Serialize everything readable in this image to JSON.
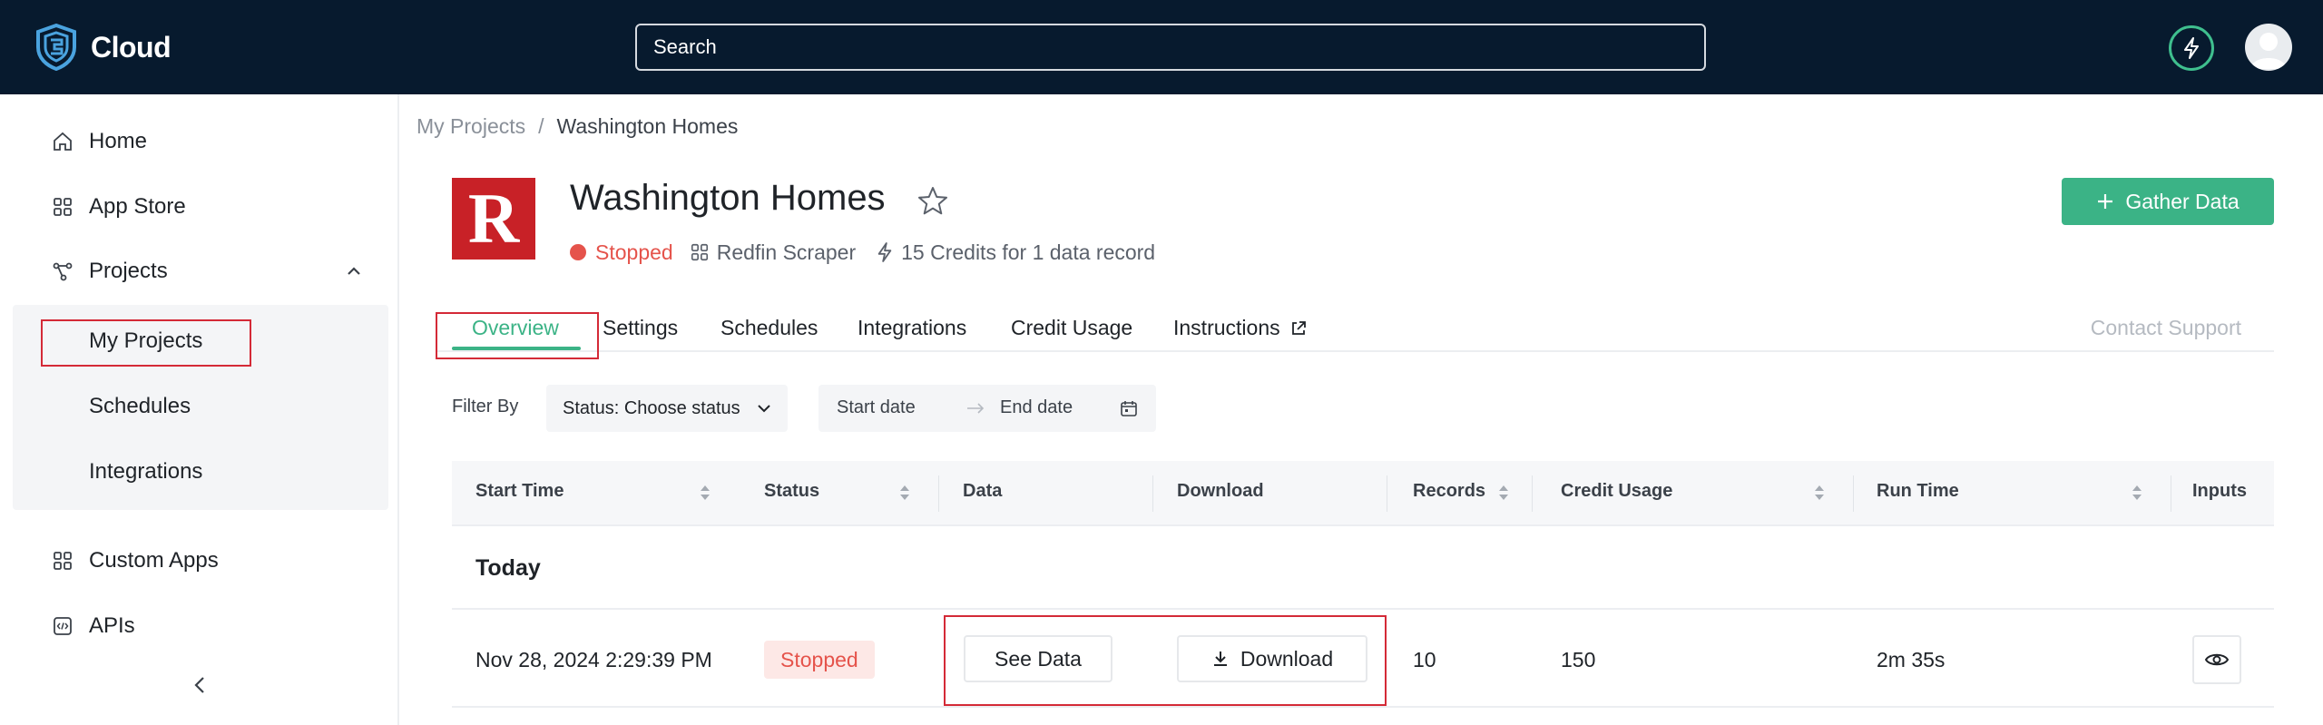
{
  "header": {
    "brand": "Cloud",
    "search_placeholder": "Search",
    "icons": [
      "brand-shield-logo",
      "bolt-icon",
      "user-avatar"
    ]
  },
  "sidebar": {
    "items": [
      {
        "label": "Home",
        "icon": "home-icon"
      },
      {
        "label": "App Store",
        "icon": "apps-grid-icon"
      },
      {
        "label": "Projects",
        "icon": "projects-icon",
        "expanded": true
      },
      {
        "label": "Custom Apps",
        "icon": "apps-grid-icon"
      },
      {
        "label": "APIs",
        "icon": "code-icon"
      }
    ],
    "sub_items": [
      "My Projects",
      "Schedules",
      "Integrations"
    ],
    "selected": "My Projects"
  },
  "breadcrumb": {
    "root": "My Projects",
    "separator": "/",
    "current": "Washington Homes"
  },
  "project": {
    "logo_letter": "R",
    "title": "Washington Homes",
    "status": "Stopped",
    "scraper": "Redfin Scraper",
    "credits": "15 Credits for 1 data record",
    "gather_button": "Gather Data"
  },
  "tabs": {
    "items": [
      "Overview",
      "Settings",
      "Schedules",
      "Integrations",
      "Credit Usage",
      "Instructions"
    ],
    "active": "Overview",
    "contact": "Contact Support"
  },
  "filters": {
    "label": "Filter By",
    "status_select": "Status: Choose status",
    "start_date_placeholder": "Start date",
    "end_date_placeholder": "End date"
  },
  "table": {
    "headers": [
      "Start Time",
      "Status",
      "Data",
      "Download",
      "Records",
      "Credit Usage",
      "Run Time",
      "Inputs"
    ],
    "group": "Today",
    "rows": [
      {
        "start_time": "Nov 28, 2024 2:29:39 PM",
        "status": "Stopped",
        "data_button": "See Data",
        "download_button": "Download",
        "records": "10",
        "credit_usage": "150",
        "run_time": "2m 35s"
      }
    ]
  },
  "colors": {
    "topbar": "#071a2e",
    "accent_green": "#3bb386",
    "status_red": "#e5534b",
    "highlight_red": "#d42a37",
    "project_logo_red": "#c82127"
  }
}
